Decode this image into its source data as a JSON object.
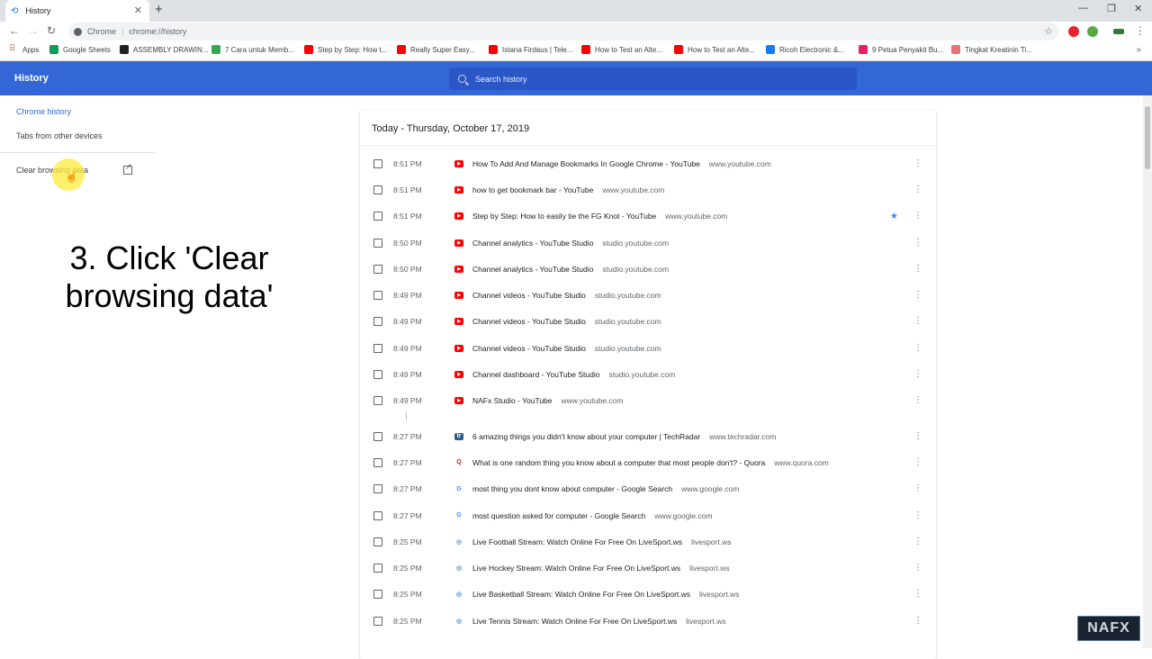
{
  "tab": {
    "title": "History",
    "icon": "history-icon"
  },
  "omnibox": {
    "scheme_label": "Chrome",
    "url": "chrome://history"
  },
  "bookmarks": [
    {
      "label": "Apps",
      "color": "#ea4335"
    },
    {
      "label": "Google Sheets",
      "color": "#0f9d58"
    },
    {
      "label": "ASSEMBLY DRAWIN...",
      "color": "#202124"
    },
    {
      "label": "7 Cara untuk Memb...",
      "color": "#34a853"
    },
    {
      "label": "Step by Step: How t...",
      "color": "#ff0000"
    },
    {
      "label": "Really Super Easy...",
      "color": "#ff0000"
    },
    {
      "label": "Istana Firdaus | Tele...",
      "color": "#ff0000"
    },
    {
      "label": "How to Test an Alte...",
      "color": "#ff0000"
    },
    {
      "label": "How to Test an Alte...",
      "color": "#ff0000"
    },
    {
      "label": "Ricoh Electronic &...",
      "color": "#1877f2"
    },
    {
      "label": "9 Petua Penyakit Bu...",
      "color": "#e91e63"
    },
    {
      "label": "Tingkat Kreatinin Ti...",
      "color": "#e57373"
    }
  ],
  "header": {
    "title": "History",
    "search_placeholder": "Search history"
  },
  "sidebar": {
    "chrome_history": "Chrome history",
    "tabs_other_devices": "Tabs from other devices",
    "clear_browsing_data": "Clear browsing data"
  },
  "annotation": "3. Click 'Clear browsing data'",
  "history": {
    "date_heading": "Today - Thursday, October 17, 2019",
    "items": [
      {
        "time": "8:51 PM",
        "title": "How To Add And Manage Bookmarks In Google Chrome - YouTube",
        "domain": "www.youtube.com",
        "icon": "youtube-icon"
      },
      {
        "time": "8:51 PM",
        "title": "how to get bookmark bar - YouTube",
        "domain": "www.youtube.com",
        "icon": "youtube-icon"
      },
      {
        "time": "8:51 PM",
        "title": "Step by Step: How to easily tie the FG Knot - YouTube",
        "domain": "www.youtube.com",
        "icon": "youtube-icon",
        "starred": true
      },
      {
        "time": "8:50 PM",
        "title": "Channel analytics - YouTube Studio",
        "domain": "studio.youtube.com",
        "icon": "youtube-icon"
      },
      {
        "time": "8:50 PM",
        "title": "Channel analytics - YouTube Studio",
        "domain": "studio.youtube.com",
        "icon": "youtube-icon"
      },
      {
        "time": "8:49 PM",
        "title": "Channel videos - YouTube Studio",
        "domain": "studio.youtube.com",
        "icon": "youtube-icon"
      },
      {
        "time": "8:49 PM",
        "title": "Channel videos - YouTube Studio",
        "domain": "studio.youtube.com",
        "icon": "youtube-icon"
      },
      {
        "time": "8:49 PM",
        "title": "Channel videos - YouTube Studio",
        "domain": "studio.youtube.com",
        "icon": "youtube-icon"
      },
      {
        "time": "8:49 PM",
        "title": "Channel dashboard - YouTube Studio",
        "domain": "studio.youtube.com",
        "icon": "youtube-icon"
      },
      {
        "time": "8:49 PM",
        "title": "NAFx Studio - YouTube",
        "domain": "www.youtube.com",
        "icon": "youtube-icon"
      },
      {
        "time": "8:27 PM",
        "title": "6 amazing things you didn't know about your computer | TechRadar",
        "domain": "www.techradar.com",
        "icon": "techradar-icon",
        "gap_before": true
      },
      {
        "time": "8:27 PM",
        "title": "What is one random thing you know about a computer that most people don't? - Quora",
        "domain": "www.quora.com",
        "icon": "quora-icon"
      },
      {
        "time": "8:27 PM",
        "title": "most thing you dont know about computer - Google Search",
        "domain": "www.google.com",
        "icon": "google-icon"
      },
      {
        "time": "8:27 PM",
        "title": "most question asked for computer - Google Search",
        "domain": "www.google.com",
        "icon": "google-icon"
      },
      {
        "time": "8:25 PM",
        "title": "Live Football Stream: Watch Online For Free On LiveSport.ws",
        "domain": "livesport.ws",
        "icon": "livesport-icon"
      },
      {
        "time": "8:25 PM",
        "title": "Live Hockey Stream: Watch Online For Free On LiveSport.ws",
        "domain": "livesport.ws",
        "icon": "livesport-icon"
      },
      {
        "time": "8:25 PM",
        "title": "Live Basketball Stream: Watch Online For Free On LiveSport.ws",
        "domain": "livesport.ws",
        "icon": "livesport-icon"
      },
      {
        "time": "8:25 PM",
        "title": "Live Tennis Stream: Watch Online For Free On LiveSport.ws",
        "domain": "livesport.ws",
        "icon": "livesport-icon"
      }
    ]
  },
  "watermark": "NAFX",
  "colors": {
    "header_blue": "#3367d6",
    "youtube_red": "#ff0000",
    "star_blue": "#4285f4"
  }
}
